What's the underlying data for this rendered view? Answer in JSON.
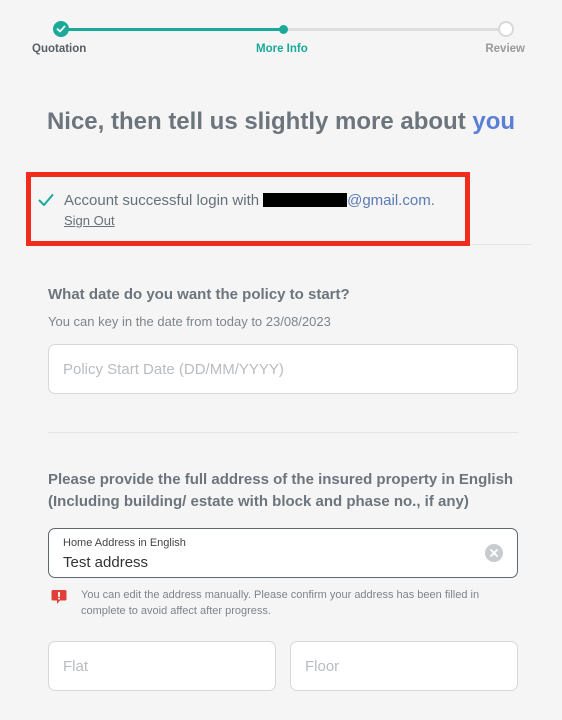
{
  "stepper": {
    "steps": [
      {
        "label": "Quotation"
      },
      {
        "label": "More Info"
      },
      {
        "label": "Review"
      }
    ]
  },
  "heading": {
    "text": "Nice, then tell us slightly more about ",
    "accent": "you"
  },
  "login": {
    "message": "Account successful login with",
    "email_domain": "@gmail.com.",
    "sign_out": "Sign Out"
  },
  "policy_start": {
    "question": "What date do you want the policy to start?",
    "hint": "You can key in the date from today to 23/08/2023",
    "placeholder": "Policy Start Date (DD/MM/YYYY)",
    "value": ""
  },
  "address": {
    "question": "Please provide the full address of the insured property in English (Including building/ estate with block and phase no., if any)",
    "field_label": "Home Address in English",
    "field_value": "Test address",
    "warning": "You can edit the address manually. Please confirm your address has been filled in complete to avoid affect after progress."
  },
  "flat": {
    "placeholder": "Flat",
    "value": ""
  },
  "floor": {
    "placeholder": "Floor",
    "value": ""
  },
  "colors": {
    "accent_teal": "#1aa99a",
    "accent_blue": "#5b7fd6",
    "highlight_red": "#f02d1c",
    "warning_red": "#e0403a"
  }
}
